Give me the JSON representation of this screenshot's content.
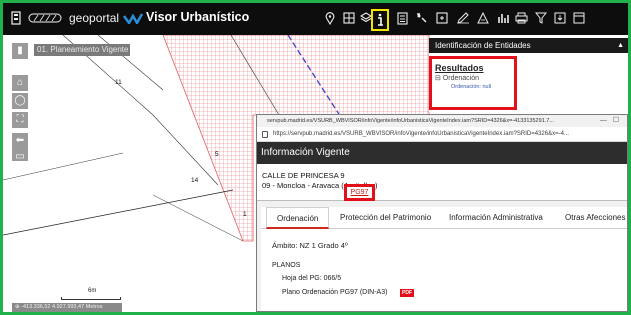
{
  "topbar": {
    "brand": "geoportal",
    "title": "Visor Urbanístico",
    "tools": [
      "location-pin-icon",
      "grid-icon",
      "layers-icon",
      "info-icon",
      "clipboard-icon",
      "draw-icon",
      "select-box-icon",
      "edit-icon",
      "measure-icon",
      "stats-icon",
      "print-icon",
      "filter-icon",
      "export-icon",
      "window-icon"
    ]
  },
  "map": {
    "layer_chip": "01. Planeamiento Vigente",
    "labels": [
      "11",
      "5",
      "14",
      "1"
    ],
    "scale_label": "6m",
    "coords": "⊕ -413.336,52 4.927.993,47 Metros"
  },
  "ident_panel": {
    "header": "Identificación de Entidades",
    "results_title": "Resultados",
    "node": "⊟ Ordenación",
    "leaf": "Ordenación: null"
  },
  "popup": {
    "window_title": "servpub.madrid.es/VSURB_WBVISOR/infoVigente/infoUrbanisticaVigenteIndex.iam?SRID=4326&x=-4133135291.7...",
    "url": "https://servpub.madrid.es/VSURB_WBVISOR/infoVigente/infoUrbanisticaVigenteIndex.iam?SRID=4326&x=-4...",
    "header": "Información Vigente",
    "address_line1": "CALLE DE PRINCESA 9",
    "address_line2": "09 - Moncloa - Aravaca (Argüelles)",
    "tabs": [
      "Ordenación",
      "Protección del Patrimonio",
      "Información Administrativa",
      "Otras Afecciones"
    ],
    "ambito": "Ámbito: NZ 1 Grado 4º",
    "planos_title": "PLANOS",
    "hoja": "Hoja del PG: 066/5",
    "plano": "Plano Ordenación PG97 (DIN-A3)",
    "pdf_badge": "PDF",
    "pg97_link": "PG97"
  }
}
